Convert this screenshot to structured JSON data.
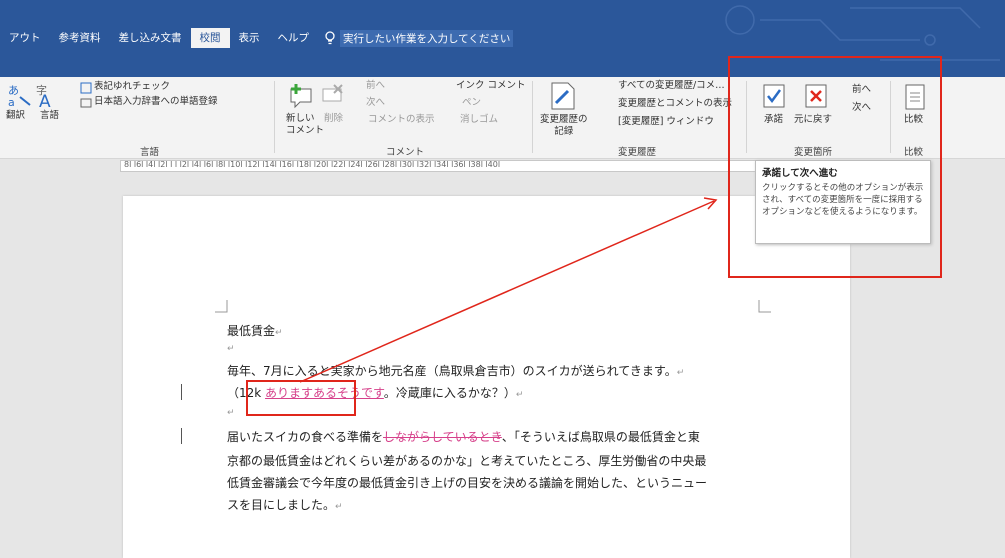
{
  "tabs": [
    "アウト",
    "参考資料",
    "差し込み文書",
    "校閲",
    "表示",
    "ヘルプ"
  ],
  "active_tab": "校閲",
  "tell_me": "実行したい作業を入力してください",
  "groups": {
    "lang": {
      "label": "言語",
      "translate": "翻訳",
      "language": "言語",
      "spell": "表記ゆれチェック",
      "dict": "日本語入力辞書への単語登録"
    },
    "comment": {
      "label": "コメント",
      "new": "新しい\nコメント",
      "delete": "削除",
      "prev": "前へ",
      "next": "次へ",
      "show": "コメントの表示",
      "ink": "インク コメント",
      "pen": "ペン",
      "eraser": "消しゴム"
    },
    "track": {
      "label": "変更履歴",
      "record": "変更履歴の\n記録",
      "markup": "すべての変更履歴/コメ…",
      "showmarkup": "変更履歴とコメントの表示",
      "pane": "[変更履歴] ウィンドウ"
    },
    "changes": {
      "label": "変更箇所",
      "accept": "承諾",
      "reject": "元に戻す",
      "prev": "前へ",
      "next": "次へ"
    },
    "compare": {
      "label": "比較",
      "compare": "比較"
    }
  },
  "ruler": "8l l6l l4l l2l l l l2l l4l l6l l8l l10l l12l l14l l16l l18l l20l l22l l24l l26l l28l l30l l32l l34l l36l l38l l40l",
  "tooltip": {
    "title": "承諾して次へ進む",
    "desc": "クリックするとその他のオプションが表示され、すべての変更箇所を一度に採用するオプションなどを使えるようになります。"
  },
  "doc": {
    "title": "最低賃金",
    "line1": "毎年、7月に入ると実家から地元名産（鳥取県倉吉市）のスイカが送られてきます。",
    "line2a": "（12k ",
    "line2ins": "ありますあるそうです",
    "line2b": "。冷蔵庫に入るかな？）",
    "line3a": "届いたスイカの食べる準備を",
    "line3del": "しながらしているとき",
    "line3b": "、「そういえば鳥取県の最低賃金と東",
    "line4": "京都の最低賃金はどれくらい差があるのかな」と考えていたところ、厚生労働省の中央最",
    "line5": "低賃金審議会で今年度の最低賃金引き上げの目安を決める議論を開始した、というニュー",
    "line6": "スを目にしました。",
    "para_mark": "↵"
  },
  "colors": {
    "ribbon_blue": "#2b579a",
    "annotation_red": "#e0261b",
    "revision_pink": "#d6408a"
  }
}
